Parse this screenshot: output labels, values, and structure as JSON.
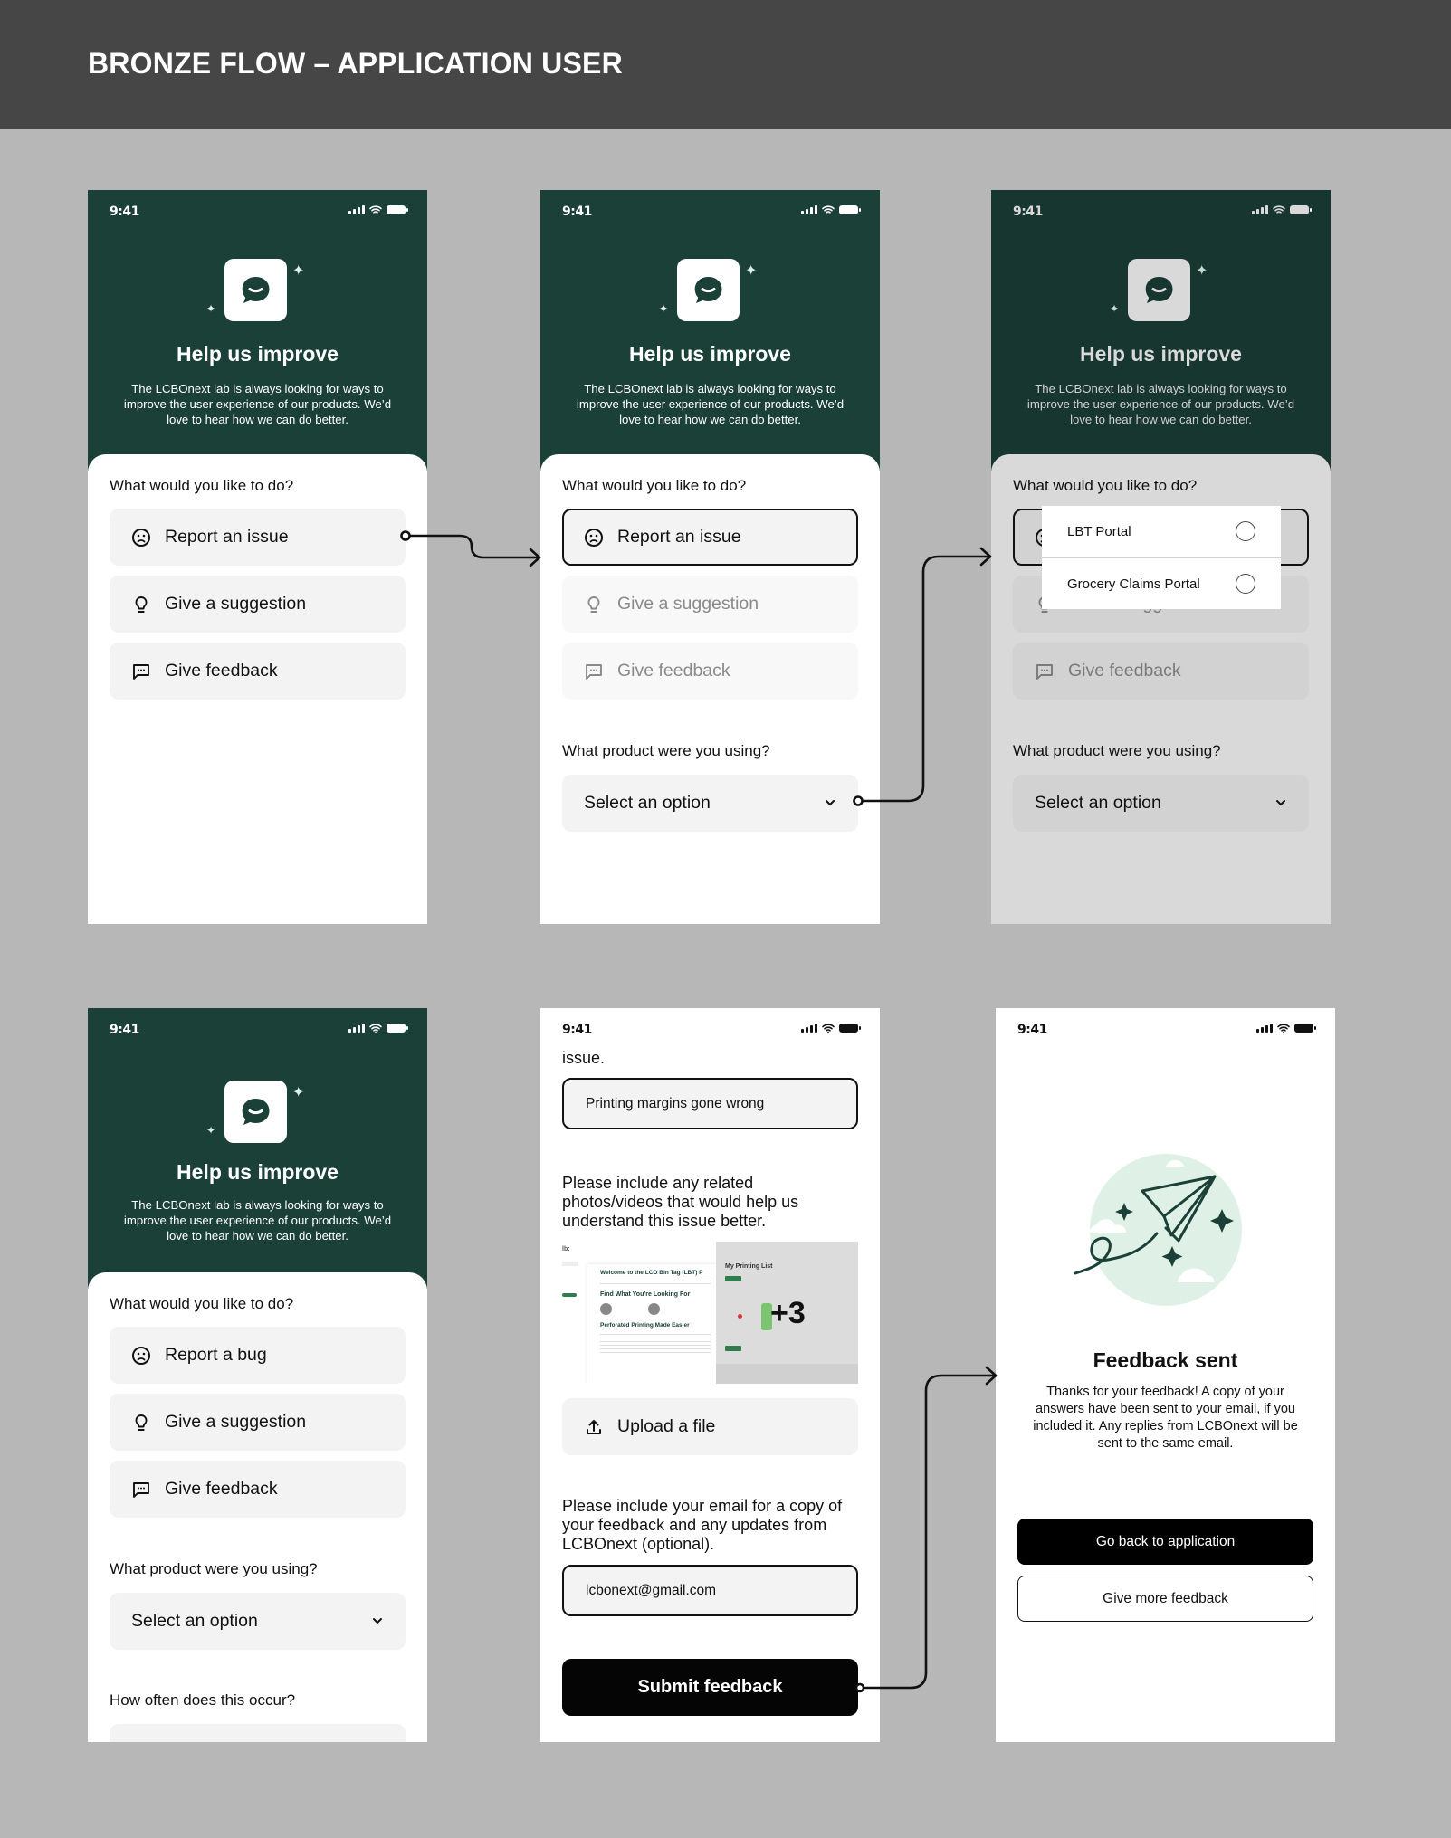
{
  "page_title": "BRONZE FLOW – APPLICATION USER",
  "colors": {
    "brand_green": "#1a4038",
    "mint": "#dff1e7",
    "field_bg": "#f3f3f3",
    "page_bg": "#b7b7b7",
    "header_bg": "#464646"
  },
  "status_bar": {
    "time": "9:41"
  },
  "intro": {
    "title": "Help us improve",
    "body": "The LCBOnext lab is always looking for ways to improve the user experience of our products. We’d love to hear how we can do better."
  },
  "screens": [
    {
      "question": "What would you like to do?",
      "options": [
        {
          "label": "Report an issue",
          "icon": "sad-face-icon",
          "state": "default"
        },
        {
          "label": "Give a suggestion",
          "icon": "lightbulb-icon",
          "state": "default"
        },
        {
          "label": "Give feedback",
          "icon": "chat-bubble-icon",
          "state": "default"
        }
      ]
    },
    {
      "question": "What would you like to do?",
      "options": [
        {
          "label": "Report an issue",
          "icon": "sad-face-icon",
          "state": "selected"
        },
        {
          "label": "Give a suggestion",
          "icon": "lightbulb-icon",
          "state": "disabled"
        },
        {
          "label": "Give feedback",
          "icon": "chat-bubble-icon",
          "state": "disabled"
        }
      ],
      "product_question": "What product were you using?",
      "product_select": "Select an option"
    },
    {
      "question": "What would you like to do?",
      "options": [
        {
          "label": "Report an issue",
          "icon": "sad-face-icon",
          "state": "selected"
        },
        {
          "label": "Give a suggestion",
          "icon": "lightbulb-icon",
          "state": "disabled"
        },
        {
          "label": "Give feedback",
          "icon": "chat-bubble-icon",
          "state": "disabled"
        }
      ],
      "product_question": "What product were you using?",
      "product_select": "Select an option",
      "dropdown_options": [
        {
          "label": "LBT Portal",
          "checked": false
        },
        {
          "label": "Grocery Claims Portal",
          "checked": false
        }
      ]
    },
    {
      "question": "What would you like to do?",
      "options": [
        {
          "label": "Report a bug",
          "icon": "sad-face-icon",
          "state": "default"
        },
        {
          "label": "Give a suggestion",
          "icon": "lightbulb-icon",
          "state": "default"
        },
        {
          "label": "Give feedback",
          "icon": "chat-bubble-icon",
          "state": "default"
        }
      ],
      "product_question": "What product were you using?",
      "product_select": "Select an option",
      "frequency_question": "How often does this occur?"
    },
    {
      "cut_text": "issue.",
      "issue_value": "Printing margins gone wrong",
      "attachments_prompt": "Please include any related photos/videos that would help us understand this issue better.",
      "attachments": {
        "left_title": "Welcome to the LCO Bin Tag (LBT) P",
        "left_h2": "Find What You’re Looking For",
        "left_h3": "Perforated Printing Made Easier",
        "right_title": "My Printing List",
        "extra_count": "+3"
      },
      "upload_label": "Upload a file",
      "email_prompt": "Please include your email for a copy of your feedback and any updates from LCBOnext (optional).",
      "email_value": "lcbonext@gmail.com",
      "submit_label": "Submit feedback"
    },
    {
      "title": "Feedback sent",
      "body": "Thanks for your feedback! A copy of your answers have been sent to your email, if you included it. Any replies from LCBOnext will be sent to the same email.",
      "primary_button": "Go back to application",
      "secondary_button": "Give more feedback"
    }
  ]
}
